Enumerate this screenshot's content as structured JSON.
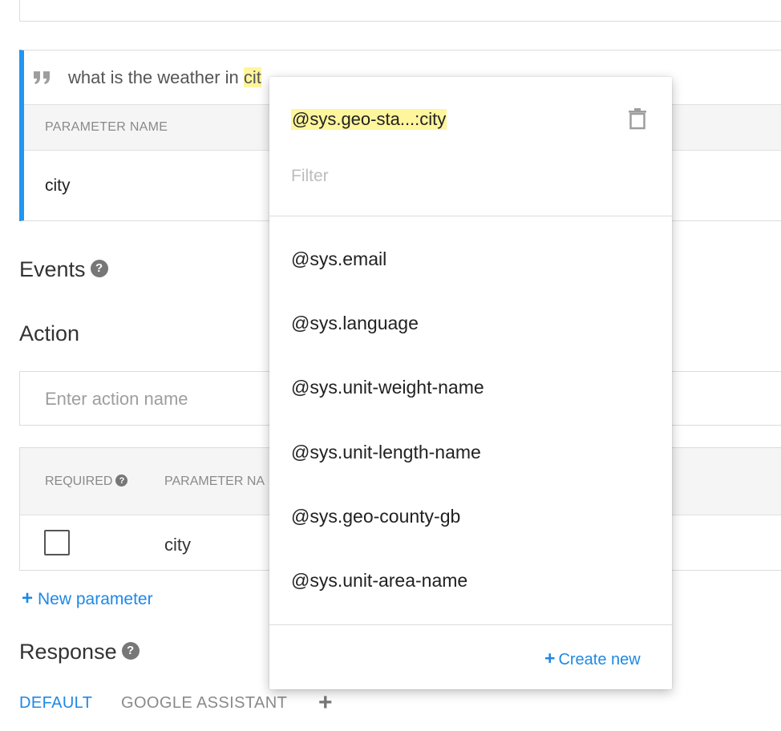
{
  "training_phrase": {
    "text_before": "what is the weather in ",
    "highlighted": "cit"
  },
  "phrase_table": {
    "header": "PARAMETER NAME",
    "value": "city"
  },
  "events": {
    "title": "Events",
    "help": "?"
  },
  "action": {
    "title": "Action",
    "placeholder": "Enter action name"
  },
  "params_table": {
    "col_required": "REQUIRED",
    "col_param_name": "PARAMETER NA",
    "row_value": "city"
  },
  "new_parameter": {
    "plus": "+",
    "label": "New parameter"
  },
  "response": {
    "title": "Response",
    "tabs": [
      "DEFAULT",
      "GOOGLE ASSISTANT"
    ],
    "add": "+"
  },
  "dropdown": {
    "selected": "@sys.geo-sta...:city",
    "filter_placeholder": "Filter",
    "items": [
      "@sys.email",
      "@sys.language",
      "@sys.unit-weight-name",
      "@sys.unit-length-name",
      "@sys.geo-county-gb",
      "@sys.unit-area-name"
    ],
    "create_plus": "+",
    "create_label": "Create new"
  },
  "colors": {
    "accent": "#1e88e5",
    "highlight": "#fff59d",
    "phrase_border": "#2196f3"
  },
  "icons": [
    "quote-icon",
    "help-icon",
    "trash-icon",
    "plus-icon"
  ]
}
